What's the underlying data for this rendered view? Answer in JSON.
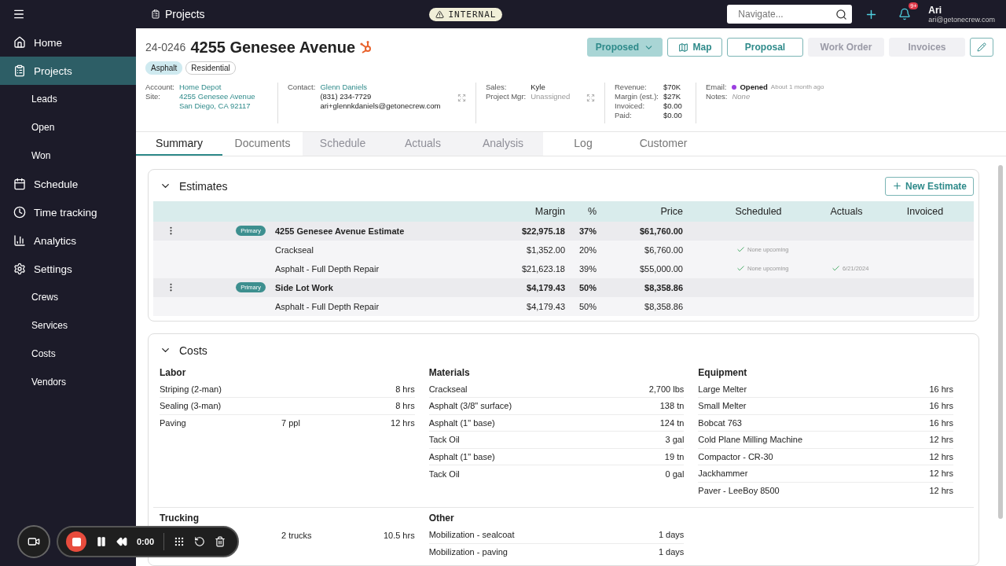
{
  "topbar": {
    "title": "Projects",
    "badge": "INTERNAL",
    "search": {
      "placeholder": "Navigate..."
    },
    "notifications": "9+",
    "user": {
      "name": "Ari",
      "email": "ari@getonecrew.com"
    }
  },
  "sidebar": {
    "items": [
      {
        "label": "Home",
        "selected": false
      },
      {
        "label": "Projects",
        "selected": true,
        "children": [
          {
            "label": "Leads",
            "selected": false
          },
          {
            "label": "Open",
            "selected": false
          },
          {
            "label": "Won",
            "selected": false
          }
        ]
      },
      {
        "label": "Schedule",
        "selected": false
      },
      {
        "label": "Time tracking",
        "selected": false
      },
      {
        "label": "Analytics",
        "selected": false
      },
      {
        "label": "Settings",
        "selected": false,
        "children": [
          {
            "label": "Crews",
            "selected": false
          },
          {
            "label": "Services",
            "selected": false
          },
          {
            "label": "Costs",
            "selected": false
          },
          {
            "label": "Vendors",
            "selected": false
          }
        ]
      }
    ]
  },
  "project": {
    "number": "24-0246",
    "title": "4255 Genesee Avenue",
    "tags": [
      {
        "label": "Asphalt",
        "kind": "filled"
      },
      {
        "label": "Residential",
        "kind": "outline"
      }
    ],
    "actions": [
      {
        "label": "Proposed",
        "kind": "status",
        "disabled": false
      },
      {
        "label": "Map",
        "kind": "map",
        "disabled": false
      },
      {
        "label": "Proposal",
        "kind": "outline",
        "disabled": false
      },
      {
        "label": "Work Order",
        "kind": "outline",
        "disabled": true
      },
      {
        "label": "Invoices",
        "kind": "outline",
        "disabled": true
      }
    ],
    "info": [
      {
        "expandable": false,
        "fields": [
          {
            "label": "Account:",
            "kind": "link",
            "values": [
              "Home Depot"
            ]
          },
          {
            "label": "Site:",
            "kind": "link",
            "values": [
              "4255 Genesee Avenue",
              "San Diego, CA 92117"
            ]
          }
        ]
      },
      {
        "expandable": true,
        "fields": [
          {
            "label": "Contact:",
            "kind": "link",
            "values": [
              "Glenn Daniels"
            ]
          },
          {
            "kind": "text",
            "values": [
              "(831) 234-7729",
              "ari+glennkdaniels@getonecrew.com"
            ]
          }
        ]
      },
      {
        "expandable": true,
        "fields": [
          {
            "label": "Sales:",
            "kind": "text",
            "values": [
              "Kyle"
            ]
          },
          {
            "label": "Project Mgr:",
            "kind": "muted",
            "values": [
              "Unassigned"
            ]
          }
        ]
      },
      {
        "expandable": false,
        "fields": [
          {
            "label": "Revenue:",
            "kind": "text",
            "values": [
              "$70K"
            ]
          },
          {
            "label": "Margin (est.):",
            "kind": "text",
            "values": [
              "$27K"
            ]
          },
          {
            "label": "Invoiced:",
            "kind": "text",
            "values": [
              "$0.00"
            ]
          },
          {
            "label": "Paid:",
            "kind": "text",
            "values": [
              "$0.00"
            ]
          }
        ]
      },
      {
        "expandable": false,
        "fields": [
          {
            "label": "Email:",
            "kind": "status",
            "color": "#9b3fe0",
            "values": [
              "Opened",
              "About 1 month ago"
            ]
          },
          {
            "label": "Notes:",
            "kind": "italic",
            "values": [
              "None"
            ]
          }
        ]
      }
    ]
  },
  "tabs": [
    {
      "label": "Summary",
      "selected": true,
      "disabled": false
    },
    {
      "label": "Documents",
      "selected": false,
      "disabled": false
    },
    {
      "label": "Schedule",
      "selected": false,
      "disabled": true
    },
    {
      "label": "Actuals",
      "selected": false,
      "disabled": true
    },
    {
      "label": "Analysis",
      "selected": false,
      "disabled": true
    },
    {
      "label": "Log",
      "selected": false,
      "disabled": false
    },
    {
      "label": "Customer",
      "selected": false,
      "disabled": false
    }
  ],
  "estimates": {
    "title": "Estimates",
    "new_button": "New Estimate",
    "columns": [
      "Margin",
      "%",
      "Price",
      "Scheduled",
      "Actuals",
      "Invoiced"
    ],
    "rows": [
      {
        "kind": "estimate",
        "badge": "Primary",
        "name": "4255 Genesee Avenue Estimate",
        "margin": "$22,975.18",
        "percent": "37%",
        "price": "$61,760.00"
      },
      {
        "kind": "item",
        "name": "Crackseal",
        "margin": "$1,352.00",
        "percent": "20%",
        "price": "$6,760.00",
        "scheduled": "None upcoming"
      },
      {
        "kind": "item",
        "name": "Asphalt - Full Depth Repair",
        "margin": "$21,623.18",
        "percent": "39%",
        "price": "$55,000.00",
        "scheduled": "None upcoming",
        "actuals": "6/21/2024"
      },
      {
        "kind": "estimate",
        "badge": "Primary",
        "name": "Side Lot Work",
        "margin": "$4,179.43",
        "percent": "50%",
        "price": "$8,358.86"
      },
      {
        "kind": "item",
        "name": "Asphalt - Full Depth Repair",
        "margin": "$4,179.43",
        "percent": "50%",
        "price": "$8,358.86"
      }
    ]
  },
  "costs": {
    "title": "Costs",
    "rows": [
      [
        {
          "title": "Labor",
          "items": [
            {
              "name": "Striping (2-man)",
              "value": "8 hrs"
            },
            {
              "name": "Sealing (3-man)",
              "value": "8 hrs"
            },
            {
              "name": "Paving",
              "quantity": "7 ppl",
              "value": "12 hrs"
            }
          ]
        },
        {
          "title": "Materials",
          "items": [
            {
              "name": "Crackseal",
              "value": "2,700 lbs"
            },
            {
              "name": "Asphalt (3/8\" surface)",
              "value": "138 tn"
            },
            {
              "name": "Asphalt (1\" base)",
              "value": "124 tn"
            },
            {
              "name": "Tack Oil",
              "value": "3 gal"
            },
            {
              "name": "Asphalt (1\" base)",
              "value": "19 tn"
            },
            {
              "name": "Tack Oil",
              "value": "0 gal"
            }
          ]
        },
        {
          "title": "Equipment",
          "items": [
            {
              "name": "Large Melter",
              "value": "16 hrs"
            },
            {
              "name": "Small Melter",
              "value": "16 hrs"
            },
            {
              "name": "Bobcat 763",
              "value": "16 hrs"
            },
            {
              "name": "Cold Plane Milling Machine",
              "value": "12 hrs"
            },
            {
              "name": "Compactor - CR-30",
              "value": "12 hrs"
            },
            {
              "name": "Jackhammer",
              "value": "12 hrs"
            },
            {
              "name": "Paver - LeeBoy 8500",
              "value": "12 hrs"
            }
          ]
        }
      ],
      [
        {
          "title": "Trucking",
          "items": [
            {
              "quantity": "2 trucks",
              "value": "10.5 hrs"
            }
          ]
        },
        {
          "title": "Other",
          "items": [
            {
              "name": "Mobilization - sealcoat",
              "value": "1 days"
            },
            {
              "name": "Mobilization - paving",
              "value": "1 days"
            }
          ]
        }
      ]
    ]
  },
  "recorder": {
    "time": "0:00"
  }
}
